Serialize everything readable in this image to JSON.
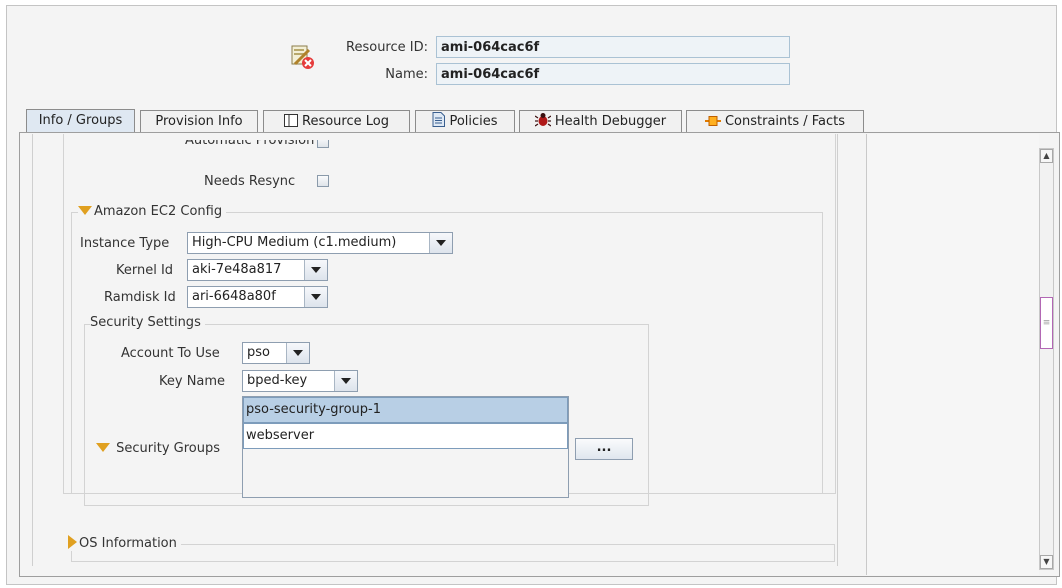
{
  "header": {
    "resource_id_label": "Resource ID:",
    "resource_id_value": "ami-064cac6f",
    "name_label": "Name:",
    "name_value": "ami-064cac6f"
  },
  "tabs": [
    {
      "label": "Info / Groups",
      "icon": "none",
      "active": true
    },
    {
      "label": "Provision Info",
      "icon": "none",
      "active": false
    },
    {
      "label": "Resource Log",
      "icon": "log-icon",
      "active": false
    },
    {
      "label": "Policies",
      "icon": "document-icon",
      "active": false
    },
    {
      "label": "Health Debugger",
      "icon": "bug-icon",
      "active": false
    },
    {
      "label": "Constraints / Facts",
      "icon": "constraint-icon",
      "active": false
    }
  ],
  "form": {
    "automatic_provision_label": "Automatic Provision",
    "needs_resync_label": "Needs Resync",
    "ec2_group_title": "Amazon EC2 Config",
    "instance_type_label": "Instance Type",
    "instance_type_value": "High-CPU Medium (c1.medium)",
    "kernel_id_label": "Kernel Id",
    "kernel_id_value": "aki-7e48a817",
    "ramdisk_id_label": "Ramdisk Id",
    "ramdisk_id_value": "ari-6648a80f",
    "security_settings_title": "Security Settings",
    "account_label": "Account To Use",
    "account_value": "pso",
    "key_name_label": "Key Name",
    "key_name_value": "bped-key",
    "security_groups_label": "Security Groups",
    "security_groups": [
      "pso-security-group-1",
      "webserver"
    ],
    "browse_button_label": "...",
    "os_info_title": "OS Information"
  },
  "colors": {
    "accent_triangle": "#e0a020",
    "selected_row": "#b8cfe5",
    "active_tab": "#dfe8f2"
  }
}
